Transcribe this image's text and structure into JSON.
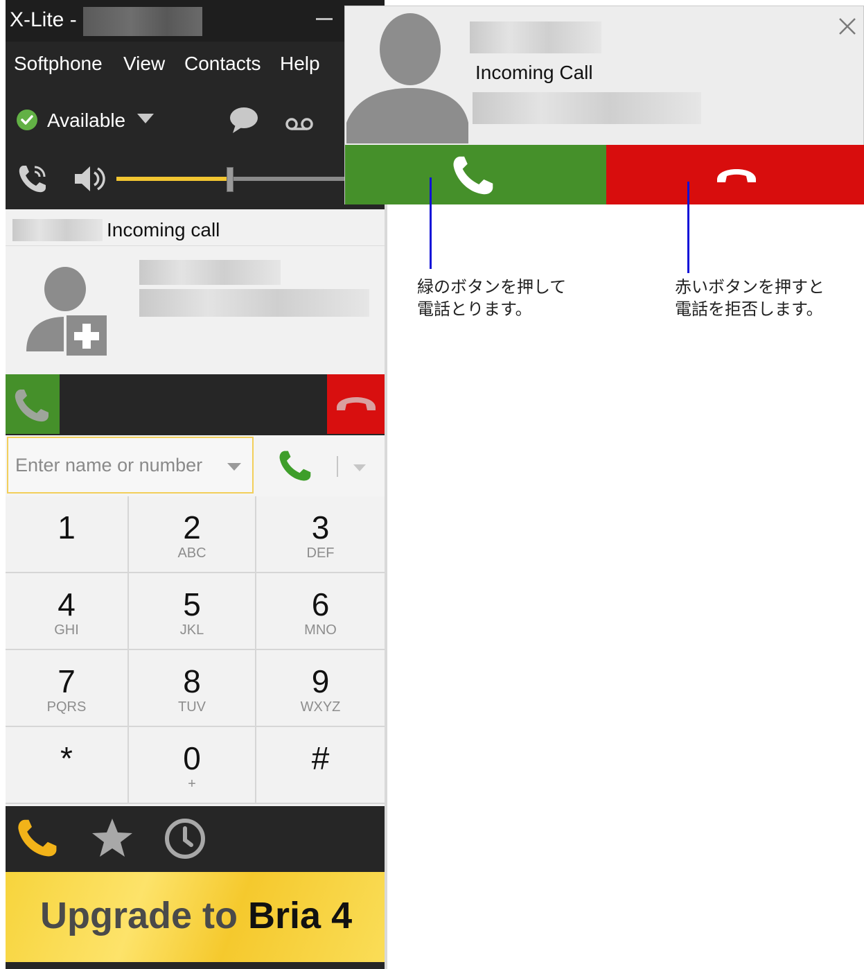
{
  "window": {
    "title": "X-Lite -"
  },
  "menu": {
    "items": [
      "Softphone",
      "View",
      "Contacts",
      "Help"
    ]
  },
  "status": {
    "label": "Available"
  },
  "volume": {
    "level": 0.42
  },
  "incoming_panel": {
    "header_label": "Incoming call"
  },
  "dialer": {
    "placeholder": "Enter name or number"
  },
  "keypad": [
    {
      "digit": "1",
      "letters": ""
    },
    {
      "digit": "2",
      "letters": "ABC"
    },
    {
      "digit": "3",
      "letters": "DEF"
    },
    {
      "digit": "4",
      "letters": "GHI"
    },
    {
      "digit": "5",
      "letters": "JKL"
    },
    {
      "digit": "6",
      "letters": "MNO"
    },
    {
      "digit": "7",
      "letters": "PQRS"
    },
    {
      "digit": "8",
      "letters": "TUV"
    },
    {
      "digit": "9",
      "letters": "WXYZ"
    },
    {
      "digit": "*",
      "letters": ""
    },
    {
      "digit": "0",
      "letters": "+"
    },
    {
      "digit": "#",
      "letters": ""
    }
  ],
  "banner": {
    "text_a": "Upgrade to",
    "text_b": "Bria 4"
  },
  "popup": {
    "title": "Incoming Call"
  },
  "annotations": {
    "answer_line1": "緑のボタンを押して",
    "answer_line2": "電話とります。",
    "decline_line1": "赤いボタンを押すと",
    "decline_line2": "電話を拒否します。"
  },
  "colors": {
    "answer_green": "#45902a",
    "decline_red": "#d80f0f",
    "accent_yellow": "#f2c531",
    "annotation_blue": "#1010d8"
  }
}
